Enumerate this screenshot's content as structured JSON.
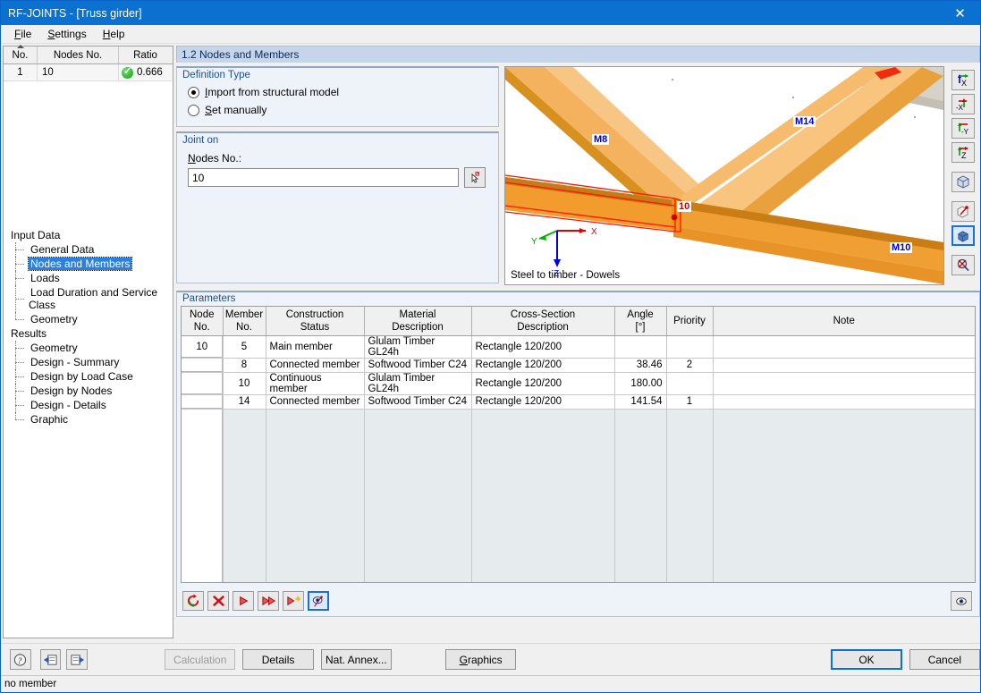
{
  "window": {
    "title": "RF-JOINTS - [Truss girder]",
    "close_label": "✕",
    "accent": "#0a71d0"
  },
  "menu": {
    "items": [
      {
        "label": "File",
        "accel": "F"
      },
      {
        "label": "Settings",
        "accel": "S"
      },
      {
        "label": "Help",
        "accel": "H"
      }
    ]
  },
  "ratio_table": {
    "columns": [
      "No.",
      "Nodes No.",
      "Ratio"
    ],
    "rows": [
      {
        "no": "1",
        "nodes_no": "10",
        "ratio": "0.666",
        "status": "ok-check-icon"
      }
    ]
  },
  "navtree": {
    "groups": [
      {
        "label": "Input Data",
        "items": [
          {
            "label": "General Data",
            "selected": false
          },
          {
            "label": "Nodes and Members",
            "selected": true
          },
          {
            "label": "Loads",
            "selected": false
          },
          {
            "label": "Load Duration and Service Class",
            "selected": false
          },
          {
            "label": "Geometry",
            "selected": false
          }
        ]
      },
      {
        "label": "Results",
        "items": [
          {
            "label": "Geometry",
            "selected": false
          },
          {
            "label": "Design - Summary",
            "selected": false
          },
          {
            "label": "Design by Load Case",
            "selected": false
          },
          {
            "label": "Design by Nodes",
            "selected": false
          },
          {
            "label": "Design - Details",
            "selected": false
          },
          {
            "label": "Graphic",
            "selected": false
          }
        ]
      }
    ]
  },
  "section": {
    "title": "1.2 Nodes and Members"
  },
  "definition_type": {
    "title": "Definition Type",
    "options": [
      {
        "label": "Import from structural model",
        "accel": "I",
        "selected": true
      },
      {
        "label": "Set manually",
        "accel": "S",
        "selected": false
      }
    ]
  },
  "joint_on": {
    "title": "Joint on",
    "field_label": "Nodes No.:",
    "value": "10",
    "placeholder": "",
    "pick_icon": "pick-from-model-icon"
  },
  "graphic_view": {
    "caption": "Steel to timber - Dowels",
    "member_labels": [
      "M8",
      "M14",
      "M10"
    ],
    "node_label": "10",
    "axes": [
      "X",
      "Y",
      "Z"
    ],
    "colors": {
      "timber_light": "#f5b860",
      "timber_mid": "#f0a840",
      "timber_dark": "#cf8a22",
      "highlight": "#ff2200",
      "steel_gray": "#d6d2c8"
    }
  },
  "view_toolbar": {
    "buttons": [
      {
        "name": "view-x-icon",
        "label": "X"
      },
      {
        "name": "view-neg-x-icon",
        "label": "-X"
      },
      {
        "name": "view-neg-y-icon",
        "label": "-Y"
      },
      {
        "name": "view-z-icon",
        "label": "Z"
      },
      {
        "name": "view-isometric-icon",
        "label": ""
      },
      {
        "name": "view-rotate-icon",
        "label": ""
      },
      {
        "name": "view-render-icon",
        "label": "",
        "active": true
      },
      {
        "name": "zoom-reset-icon",
        "label": ""
      }
    ]
  },
  "parameters": {
    "title": "Parameters",
    "columns": [
      {
        "line1": "Node",
        "line2": "No.",
        "width": "46"
      },
      {
        "line1": "Member",
        "line2": "No.",
        "width": "48"
      },
      {
        "line1": "Construction",
        "line2": "Status",
        "width": "110"
      },
      {
        "line1": "Material",
        "line2": "Description",
        "width": "120"
      },
      {
        "line1": "Cross-Section",
        "line2": "Description",
        "width": "160"
      },
      {
        "line1": "Angle",
        "line2": "[°]",
        "width": "58"
      },
      {
        "line1": "Priority",
        "line2": "",
        "width": "52"
      },
      {
        "line1": "Note",
        "line2": "",
        "width": "auto"
      }
    ],
    "rows": [
      {
        "node_no": "10",
        "member_no": "5",
        "construction_status": "Main member",
        "material": "Glulam Timber GL24h",
        "cross_section": "Rectangle 120/200",
        "angle": "",
        "priority": "",
        "note": ""
      },
      {
        "node_no": "",
        "member_no": "8",
        "construction_status": "Connected member",
        "material": "Softwood Timber C24",
        "cross_section": "Rectangle 120/200",
        "angle": "38.46",
        "priority": "2",
        "note": ""
      },
      {
        "node_no": "",
        "member_no": "10",
        "construction_status": "Continuous member",
        "material": "Glulam Timber GL24h",
        "cross_section": "Rectangle 120/200",
        "angle": "180.00",
        "priority": "",
        "note": ""
      },
      {
        "node_no": "",
        "member_no": "14",
        "construction_status": "Connected member",
        "material": "Softwood Timber C24",
        "cross_section": "Rectangle 120/200",
        "angle": "141.54",
        "priority": "1",
        "note": ""
      }
    ],
    "toolbar": [
      {
        "name": "refresh-icon"
      },
      {
        "name": "delete-row-icon"
      },
      {
        "name": "run-icon"
      },
      {
        "name": "run-all-icon"
      },
      {
        "name": "add-row-icon"
      },
      {
        "name": "view-selection-icon",
        "active": true
      }
    ],
    "eye_button": {
      "name": "visibility-icon"
    }
  },
  "bottom_bar": {
    "icon_buttons": [
      {
        "name": "help-icon"
      },
      {
        "name": "previous-module-icon"
      },
      {
        "name": "next-module-icon"
      }
    ],
    "buttons": [
      {
        "label": "Calculation",
        "disabled": true,
        "name": "calculation-button"
      },
      {
        "label": "Details",
        "disabled": false,
        "name": "details-button"
      },
      {
        "label": "Nat. Annex...",
        "disabled": false,
        "name": "nat-annex-button"
      },
      {
        "label": "Graphics",
        "disabled": false,
        "accel": "G",
        "name": "graphics-button"
      }
    ],
    "ok_label": "OK",
    "cancel_label": "Cancel"
  },
  "status_bar": {
    "text": "no member"
  }
}
